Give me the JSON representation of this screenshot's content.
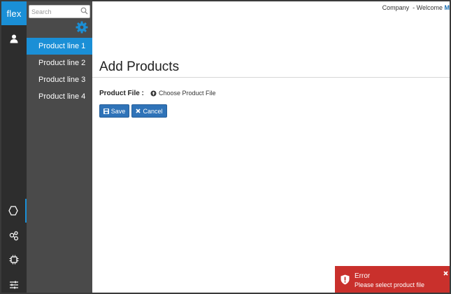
{
  "brand": {
    "logo_text": "flex"
  },
  "rail": {
    "icons": [
      "user-icon",
      "hexagon-icon",
      "hierarchy-icon",
      "chip-icon",
      "sliders-icon"
    ]
  },
  "sidebar": {
    "search_placeholder": "Search",
    "items": [
      {
        "label": "Product line 1",
        "active": true
      },
      {
        "label": "Product line 2",
        "active": false
      },
      {
        "label": "Product line 3",
        "active": false
      },
      {
        "label": "Product line 4",
        "active": false
      }
    ]
  },
  "header": {
    "company_label": "Company",
    "welcome_label": "- Welcome",
    "user_initial": "M"
  },
  "main": {
    "title": "Add Products",
    "field_label": "Product File :",
    "file_chooser_label": "Choose Product File",
    "save_label": "Save",
    "cancel_label": "Cancel"
  },
  "toast": {
    "title": "Error",
    "message": "Please select product file"
  },
  "colors": {
    "accent": "#1a8fd6",
    "button": "#2f73b8",
    "error": "#c9302c",
    "rail": "#2d2d2d",
    "sidebar": "#4a4a4a"
  }
}
